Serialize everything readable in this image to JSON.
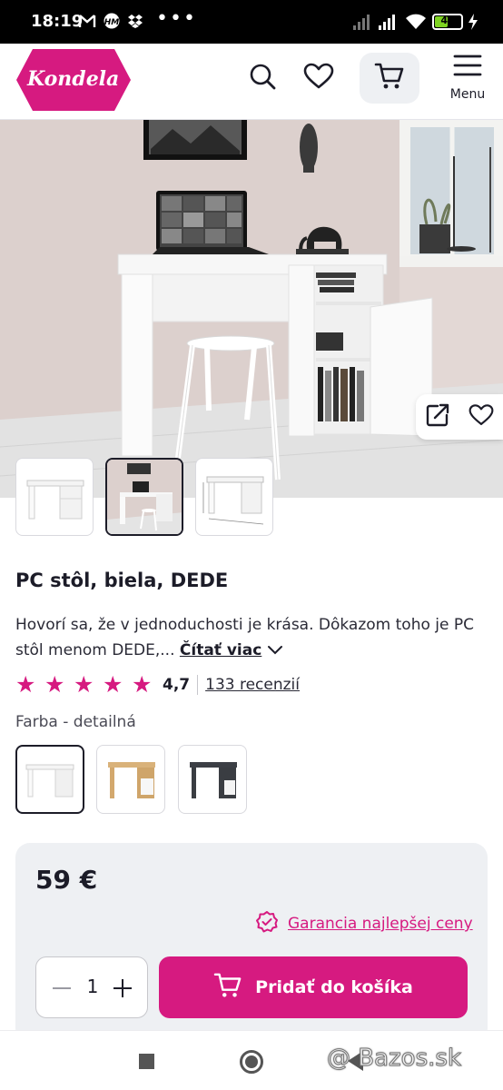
{
  "status_bar": {
    "time": "18:19",
    "battery_text": "49",
    "battery_level_percent": 49,
    "more_indicator": "•••"
  },
  "header": {
    "logo_text": "Kondela",
    "menu_label": "Menu",
    "icons": [
      "search-icon",
      "heart-icon",
      "cart-icon",
      "hamburger-menu-icon"
    ]
  },
  "gallery": {
    "thumbnail_count": 3,
    "active_thumbnail_index": 1
  },
  "product": {
    "title": "PC stôl, biela, DEDE",
    "description": "Hovorí sa, že v jednoduchosti je krása. Dôkazom toho je PC stôl menom DEDE,...",
    "read_more_label": "Čítať viac",
    "rating_value": "4,7",
    "stars_filled": 5,
    "reviews_label": "133 recenzií",
    "color_label": "Farba - detailná",
    "color_options_count": 3,
    "active_color_index": 0
  },
  "buy_box": {
    "price": "59 €",
    "guarantee_label": "Garancia najlepšej ceny",
    "quantity": "1",
    "add_to_cart_label": "Pridať do košíka"
  },
  "watermark": "@ Bazos.sk",
  "colors": {
    "brand_magenta": "#d61a80",
    "text_dark": "#1c1c28",
    "panel_grey": "#eef0f3"
  }
}
